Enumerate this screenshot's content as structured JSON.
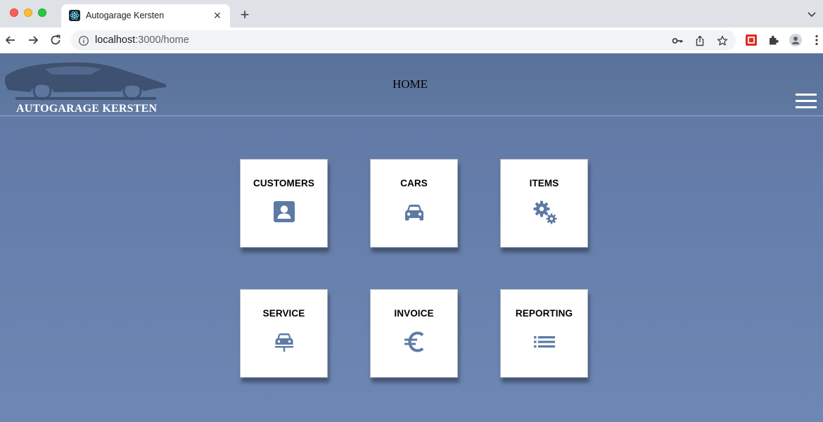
{
  "browser": {
    "tab_title": "Autogarage Kersten",
    "new_tab_symbol": "+",
    "close_symbol": "×",
    "url_host": "localhost",
    "url_path": ":3000/home"
  },
  "app": {
    "logo_text": "AUTOGARAGE KERSTEN",
    "page_title": "HOME"
  },
  "tiles": [
    {
      "label": "CUSTOMERS",
      "icon": "contact-card-icon"
    },
    {
      "label": "CARS",
      "icon": "car-icon"
    },
    {
      "label": "ITEMS",
      "icon": "gears-icon"
    },
    {
      "label": "SERVICE",
      "icon": "car-lift-icon"
    },
    {
      "label": "INVOICE",
      "icon": "euro-icon"
    },
    {
      "label": "REPORTING",
      "icon": "list-icon"
    }
  ],
  "colors": {
    "header_bg": "#5a7299",
    "page_bg": "#6a85b0",
    "icon_color": "#5d7aa5",
    "tile_bg": "#ffffff"
  }
}
